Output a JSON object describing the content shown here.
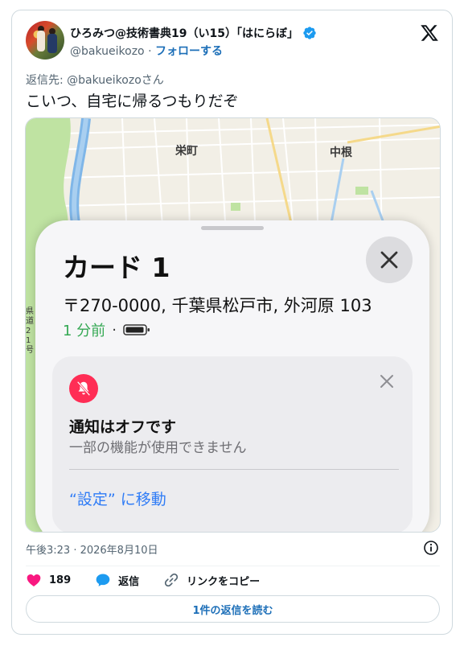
{
  "author": {
    "name": "ひろみつ@技術書典19（い15）「はにらぼ」",
    "handle": "@bakueikozo",
    "separator": "·",
    "follow_label": "フォローする"
  },
  "reply_to": "返信先: @bakueikozoさん",
  "tweet_text": "こいつ、自宅に帰るつもりだぞ",
  "media": {
    "map_labels": [
      "栄町",
      "中根",
      "県道21号"
    ],
    "card": {
      "title": "カード 1",
      "address": "〒270-0000, 千葉県松戸市, 外河原 103",
      "time_ago": "1 分前",
      "separator": "·",
      "notification": {
        "title": "通知はオフです",
        "body": "一部の機能が使用できません",
        "link": "“設定” に移動"
      }
    }
  },
  "timestamp": "午後3:23 · 2026年8月10日",
  "actions": {
    "like_count": "189",
    "reply_label": "返信",
    "copy_link_label": "リンクをコピー"
  },
  "read_replies_label": "1件の返信を読む",
  "colors": {
    "accent": "#1d6fb8",
    "like": "#f91880",
    "verified": "#1d9bf0",
    "notif_icon": "#ff2d55",
    "time_ago": "#34a853",
    "link": "#2f7cf6"
  }
}
